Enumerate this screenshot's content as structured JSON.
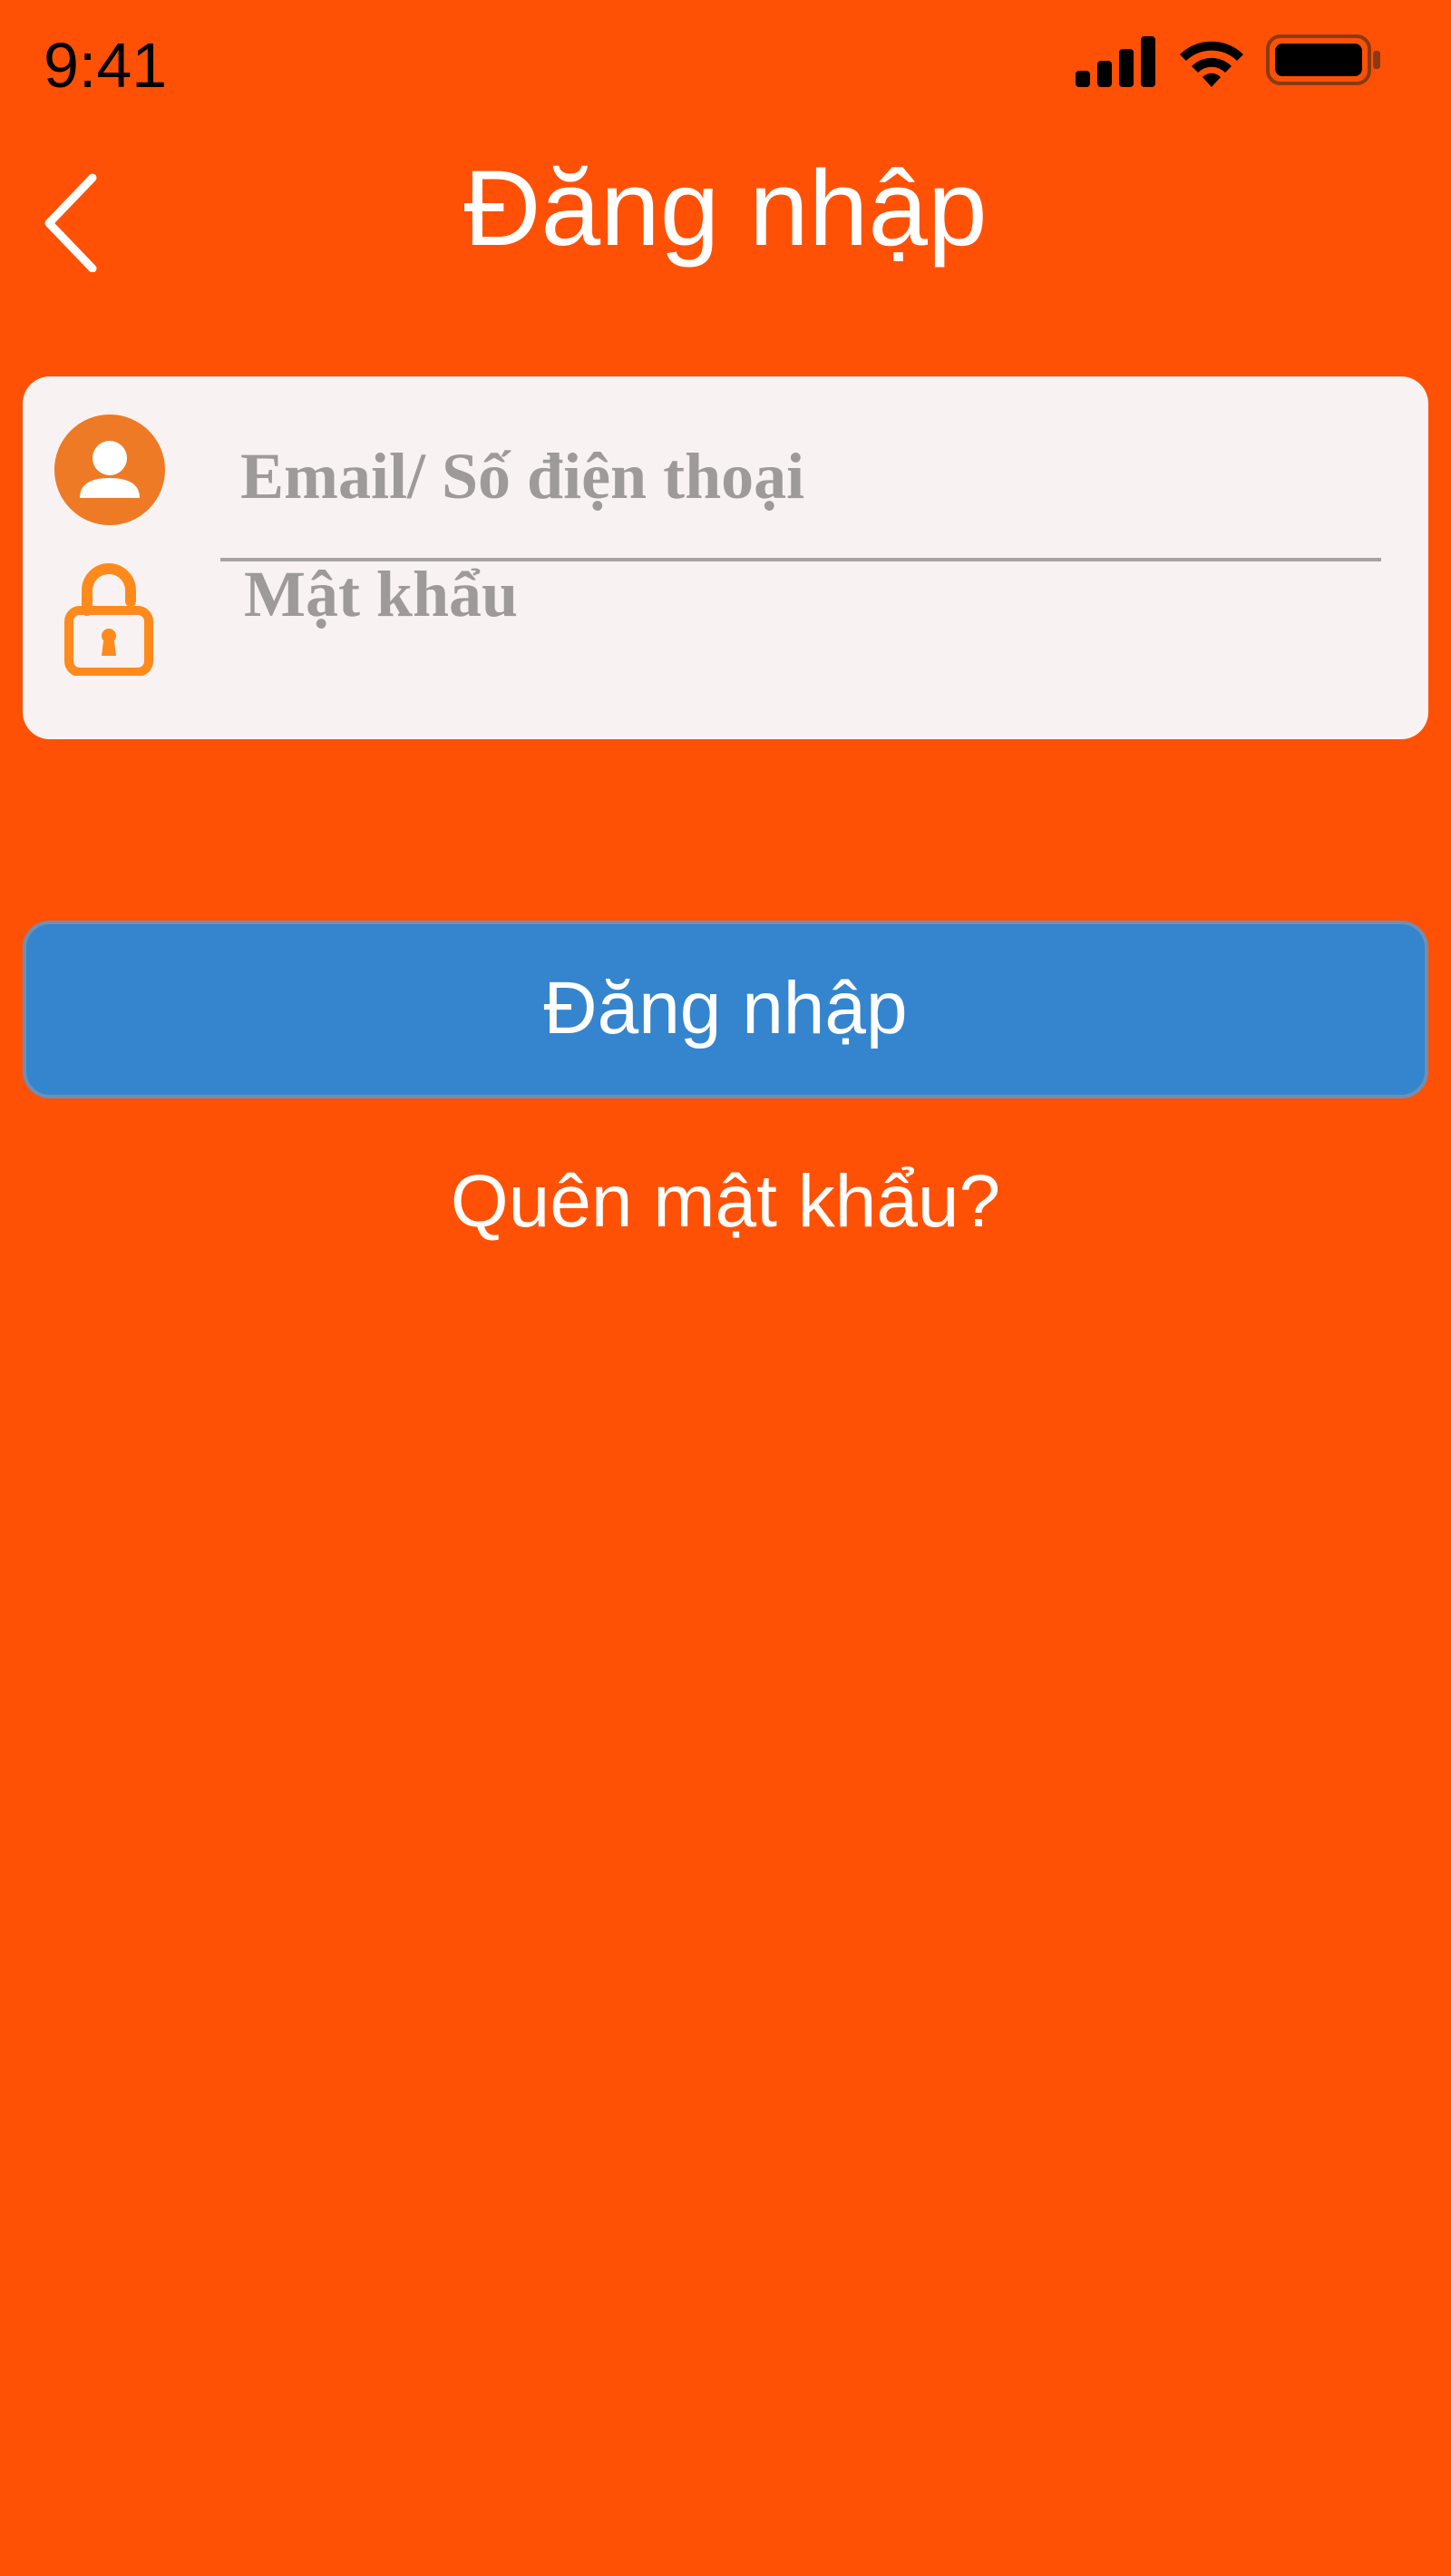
{
  "status_bar": {
    "time": "9:41",
    "icons": [
      "signal-icon",
      "wifi-icon",
      "battery-icon"
    ]
  },
  "nav": {
    "title": "Đăng nhập",
    "back_icon": "chevron-left-icon"
  },
  "login_form": {
    "email": {
      "icon": "user-icon",
      "placeholder": "Email/ Số điện thoại",
      "value": ""
    },
    "password": {
      "icon": "lock-icon",
      "placeholder": "Mật khẩu",
      "value": ""
    }
  },
  "login_button_label": "Đăng nhập",
  "forgot_password_label": "Quên mật khẩu?",
  "colors": {
    "background": "#FF5106",
    "card": "#F8F3F2",
    "button": "#3584CE",
    "icon_accent": "#EE7A26",
    "lock_accent": "#FF8A1C",
    "placeholder": "#9E9A99"
  }
}
